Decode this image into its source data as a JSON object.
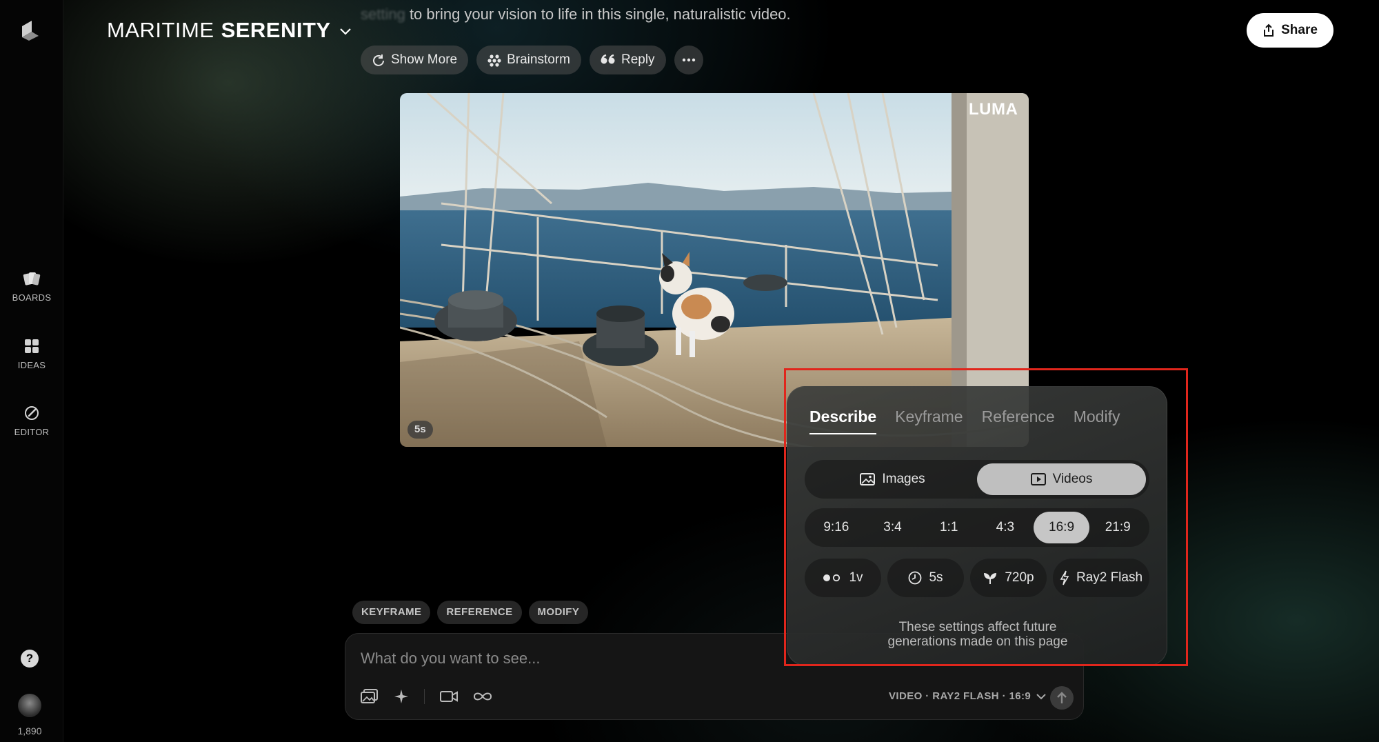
{
  "sidebar": {
    "items": [
      {
        "label": "BOARDS",
        "icon": "boards-icon"
      },
      {
        "label": "IDEAS",
        "icon": "ideas-icon"
      },
      {
        "label": "EDITOR",
        "icon": "editor-icon"
      }
    ],
    "help_label": "?",
    "credits": "1,890"
  },
  "header": {
    "title_part1": "MARITIME",
    "title_part2": "SERENITY",
    "prompt_faded": "setting",
    "prompt_text": " to bring your vision to life in this single, naturalistic video.",
    "share_label": "Share",
    "actions": [
      {
        "label": "Show More",
        "icon": "refresh-icon"
      },
      {
        "label": "Brainstorm",
        "icon": "brainstorm-icon"
      },
      {
        "label": "Reply",
        "icon": "quote-icon"
      }
    ]
  },
  "video": {
    "watermark": "LUMA",
    "duration_badge": "5s"
  },
  "composer": {
    "chips": [
      "KEYFRAME",
      "REFERENCE",
      "MODIFY"
    ],
    "placeholder": "What do you want to see...",
    "settings_summary": "VIDEO · RAY2 FLASH · 16:9"
  },
  "settings_popover": {
    "tabs": [
      {
        "label": "Describe",
        "active": true
      },
      {
        "label": "Keyframe",
        "active": false
      },
      {
        "label": "Reference",
        "active": false
      },
      {
        "label": "Modify",
        "active": false
      }
    ],
    "media_types": [
      {
        "label": "Images",
        "active": false
      },
      {
        "label": "Videos",
        "active": true
      }
    ],
    "aspect_ratios": [
      "9:16",
      "3:4",
      "1:1",
      "4:3",
      "16:9",
      "21:9"
    ],
    "selected_ratio": "16:9",
    "options": {
      "variations": "1v",
      "duration": "5s",
      "resolution": "720p",
      "model": "Ray2 Flash"
    },
    "note_line1": "These settings affect future",
    "note_line2": "generations made on this page"
  },
  "colors": {
    "highlight_box": "#e0261c",
    "share_bg": "#ffffff",
    "active_segment": "#bfbfbf"
  }
}
